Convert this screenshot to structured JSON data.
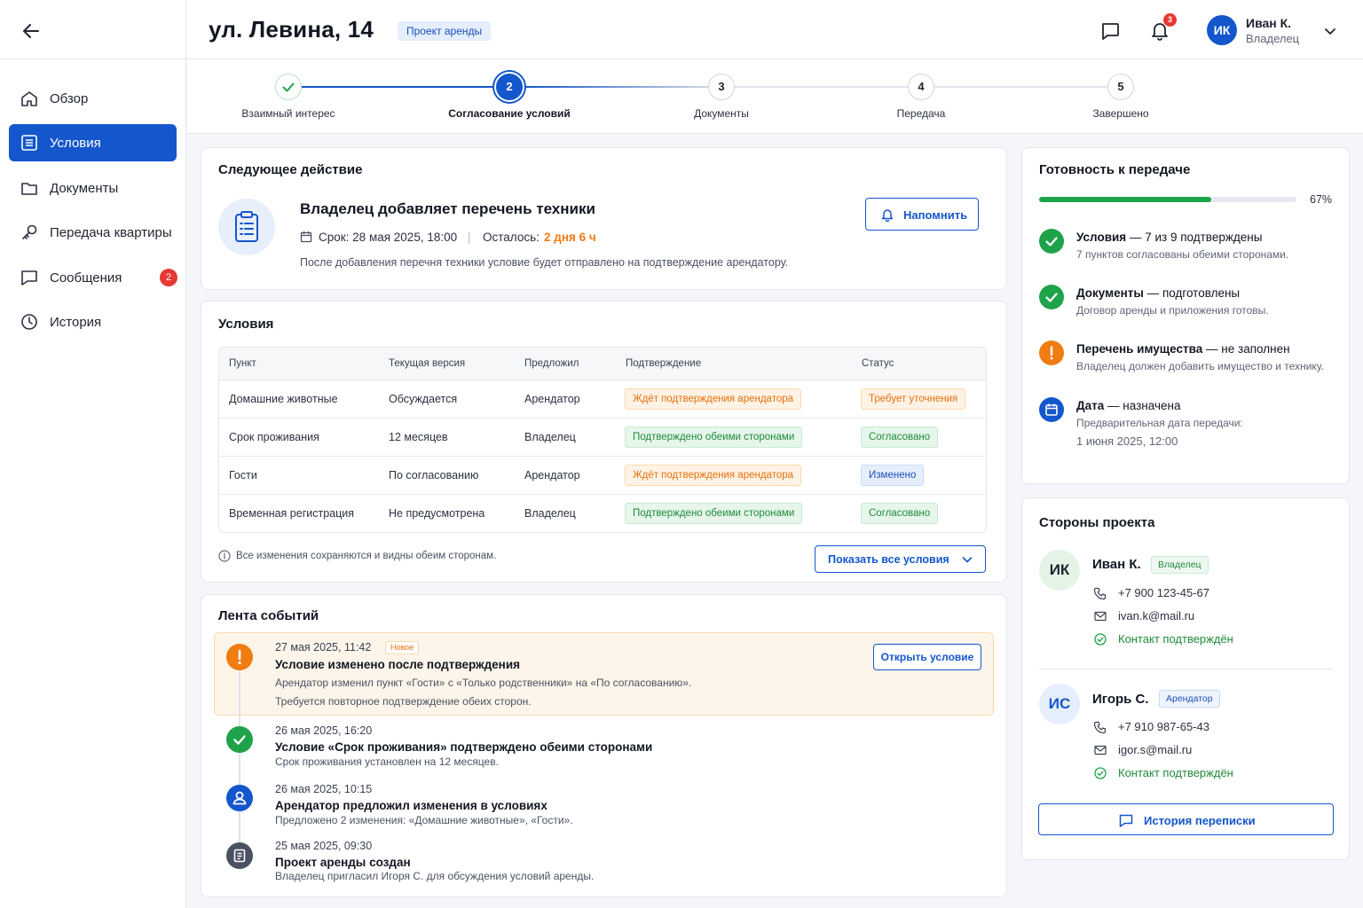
{
  "header": {
    "title": "ул. Левина, 14",
    "badge": "Проект аренды",
    "notifications_count": "3",
    "user": {
      "initials": "ИК",
      "name": "Иван К.",
      "role": "Владелец"
    }
  },
  "sidebar": {
    "items": [
      {
        "label": "Обзор",
        "icon": "home-icon"
      },
      {
        "label": "Условия",
        "icon": "list-icon",
        "active": true
      },
      {
        "label": "Документы",
        "icon": "folder-icon"
      },
      {
        "label": "Передача квартиры",
        "icon": "key-icon"
      },
      {
        "label": "Сообщения",
        "icon": "chat-icon",
        "count": "2"
      },
      {
        "label": "История",
        "icon": "clock-icon"
      }
    ]
  },
  "stepper": {
    "steps": [
      {
        "num": "",
        "label": "Взаимный интерес",
        "state": "done"
      },
      {
        "num": "2",
        "label": "Согласование условий",
        "state": "current"
      },
      {
        "num": "3",
        "label": "Документы",
        "state": "todo"
      },
      {
        "num": "4",
        "label": "Передача",
        "state": "todo"
      },
      {
        "num": "5",
        "label": "Завершено",
        "state": "todo"
      }
    ]
  },
  "next_action": {
    "section_title": "Следующее действие",
    "title": "Владелец добавляет перечень техники",
    "deadline_label": "Срок: 28 мая 2025, 18:00",
    "separator": "|",
    "remaining_label": "Осталось:",
    "remaining_value": "2 дня 6 ч",
    "description": "После добавления перечня техники условие будет отправлено на подтверждение арендатору.",
    "remind_button": "Напомнить"
  },
  "conditions": {
    "section_title": "Условия",
    "columns": [
      "Пункт",
      "Текущая версия",
      "Предложил",
      "Подтверждение",
      "Статус"
    ],
    "rows": [
      {
        "item": "Домашние животные",
        "version": "Обсуждается",
        "proposer": "Арендатор",
        "confirmation": "Ждёт подтверждения арендатора",
        "confirmation_tone": "orange",
        "status": "Требует уточнения",
        "status_tone": "orange"
      },
      {
        "item": "Срок проживания",
        "version": "12 месяцев",
        "proposer": "Владелец",
        "confirmation": "Подтверждено обеими сторонами",
        "confirmation_tone": "green",
        "status": "Согласовано",
        "status_tone": "green"
      },
      {
        "item": "Гости",
        "version": "По согласованию",
        "proposer": "Арендатор",
        "confirmation": "Ждёт подтверждения арендатора",
        "confirmation_tone": "orange",
        "status": "Изменено",
        "status_tone": "blue"
      },
      {
        "item": "Временная регистрация",
        "version": "Не предусмотрена",
        "proposer": "Владелец",
        "confirmation": "Подтверждено обеими сторонами",
        "confirmation_tone": "green",
        "status": "Согласовано",
        "status_tone": "green"
      }
    ],
    "footnote": "Все изменения сохраняются и видны обеим сторонам.",
    "show_all_button": "Показать все условия"
  },
  "feed": {
    "section_title": "Лента событий",
    "events": [
      {
        "time": "27 мая 2025, 11:42",
        "badge": "Новое",
        "title": "Условие изменено после подтверждения",
        "desc1": "Арендатор изменил пункт «Гости» с «Только родственники» на «По согласованию».",
        "desc2": "Требуется повторное подтверждение обеих сторон.",
        "button": "Открыть условие",
        "icon": "warning-icon"
      },
      {
        "time": "26 мая 2025, 16:20",
        "title": "Условие «Срок проживания» подтверждено обеими сторонами",
        "desc1": "Срок проживания установлен на 12 месяцев.",
        "icon": "check-icon"
      },
      {
        "time": "26 мая 2025, 10:15",
        "title": "Арендатор предложил изменения в условиях",
        "desc1": "Предложено 2 изменения: «Домашние животные», «Гости».",
        "icon": "user-icon"
      },
      {
        "time": "25 мая 2025, 09:30",
        "title": "Проект аренды создан",
        "desc1": "Владелец пригласил Игоря С. для обсуждения условий аренды.",
        "icon": "document-icon"
      }
    ]
  },
  "readiness": {
    "section_title": "Готовность к передаче",
    "progress": 0.67,
    "progress_label": "67%",
    "items": [
      {
        "title": "Условия",
        "dash": "—",
        "status": "7 из 9 подтверждены",
        "desc": "7 пунктов согласованы обеими сторонами.",
        "tone": "green"
      },
      {
        "title": "Документы",
        "dash": "—",
        "status": "подготовлены",
        "desc": "Договор аренды и приложения готовы.",
        "tone": "green"
      },
      {
        "title": "Перечень имущества",
        "dash": "—",
        "status": "не заполнен",
        "desc": "Владелец должен добавить имущество и технику.",
        "tone": "orange"
      },
      {
        "title": "Дата",
        "dash": "—",
        "status": "назначена",
        "desc": "Предварительная дата передачи:",
        "desc2": "1 июня 2025, 12:00",
        "tone": "blue"
      }
    ]
  },
  "parties": {
    "section_title": "Стороны проекта",
    "people": [
      {
        "initials": "ИК",
        "name": "Иван К.",
        "role": "Владелец",
        "phone": "+7 900 123-45-67",
        "email": "ivan.k@mail.ru",
        "verified": "Контакт подтверждён"
      },
      {
        "initials": "ИС",
        "name": "Игорь С.",
        "role": "Арендатор",
        "phone": "+7 910 987-65-43",
        "email": "igor.s@mail.ru",
        "verified": "Контакт подтверждён"
      }
    ],
    "history_button": "История переписки"
  },
  "colors": {
    "accent": "#1456cc",
    "success": "#1fa34a",
    "warning": "#f07c12",
    "danger": "#e53935"
  }
}
